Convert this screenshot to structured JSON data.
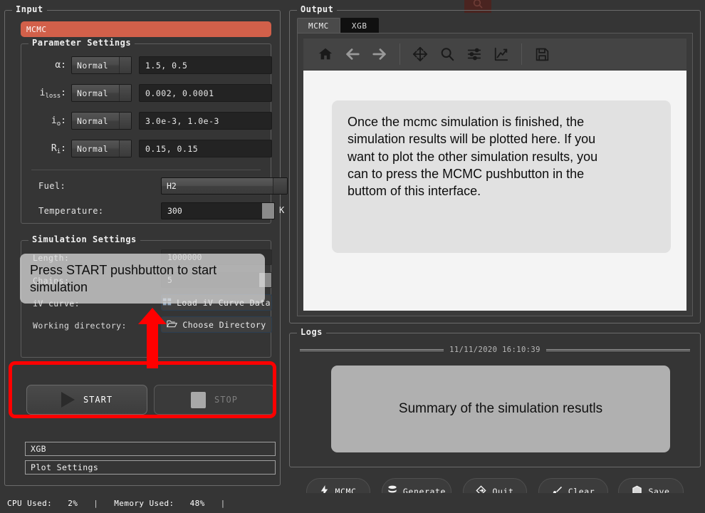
{
  "input": {
    "group_label": "Input",
    "banner": {
      "label": "MCMC",
      "color": "#d2604a"
    },
    "parameter_settings": {
      "group_label": "Parameter Settings",
      "rows": [
        {
          "symbol": "α",
          "subscript": "",
          "distribution": "Normal",
          "value": "1.5, 0.5"
        },
        {
          "symbol": "i",
          "subscript": "loss",
          "distribution": "Normal",
          "value": "0.002, 0.0001"
        },
        {
          "symbol": "i",
          "subscript": "o",
          "distribution": "Normal",
          "value": "3.0e-3, 1.0e-3"
        },
        {
          "symbol": "R",
          "subscript": "i",
          "distribution": "Normal",
          "value": "0.15, 0.15"
        }
      ],
      "fuel_label": "Fuel:",
      "fuel_value": "H2",
      "temperature_label": "Temperature:",
      "temperature_value": "300",
      "temperature_unit": "K"
    },
    "simulation_settings": {
      "group_label": "Simulation Settings",
      "length_label": "Length:",
      "length_value": "1000000",
      "chains_label": "Chains:",
      "chains_value": "5",
      "iv_curve_label": "iV curve:",
      "load_iv_button": "Load iV Curve Data",
      "working_directory_label": "Working directory:",
      "choose_directory_button": "Choose Directory",
      "tooltip": "Press START pushbutton to start simulation"
    },
    "start_button": "START",
    "stop_button": "STOP",
    "collapsibles": [
      {
        "label": "XGB"
      },
      {
        "label": "Plot Settings"
      }
    ]
  },
  "output": {
    "group_label": "Output",
    "tabs": [
      {
        "label": "MCMC",
        "active": false
      },
      {
        "label": "XGB",
        "active": true
      }
    ],
    "toolbar": [
      {
        "name": "home-icon",
        "enabled": true
      },
      {
        "name": "back-arrow-icon",
        "enabled": false
      },
      {
        "name": "forward-arrow-icon",
        "enabled": false
      },
      {
        "name": "pan-move-icon",
        "enabled": true
      },
      {
        "name": "zoom-search-icon",
        "enabled": true
      },
      {
        "name": "subplot-sliders-icon",
        "enabled": true
      },
      {
        "name": "edit-curve-icon",
        "enabled": true
      },
      {
        "name": "save-floppy-icon",
        "enabled": true
      }
    ],
    "plot_tooltip": [
      " Once the mcmc simulation is finished, the",
      "simulation results will be plotted here. If you",
      "want to plot the other simulation results, you",
      "can to press the MCMC pushbutton in the",
      "buttom of this interface."
    ]
  },
  "logs": {
    "group_label": "Logs",
    "timestamp": "11/11/2020 16:10:39",
    "summary": "Summary of the simulation resutls"
  },
  "commands": [
    {
      "label": "MCMC",
      "icon": "lightning-icon"
    },
    {
      "label": "Generate",
      "icon": "database-icon"
    },
    {
      "label": "Quit",
      "icon": "exit-diamond-icon"
    },
    {
      "label": "Clear",
      "icon": "brush-icon"
    },
    {
      "label": "Save",
      "icon": "cube-icon"
    }
  ],
  "statusbar": {
    "cpu_label": "CPU Used:",
    "cpu_value": "2%",
    "memory_label": "Memory Used:",
    "memory_value": "48%",
    "separator": "|"
  }
}
